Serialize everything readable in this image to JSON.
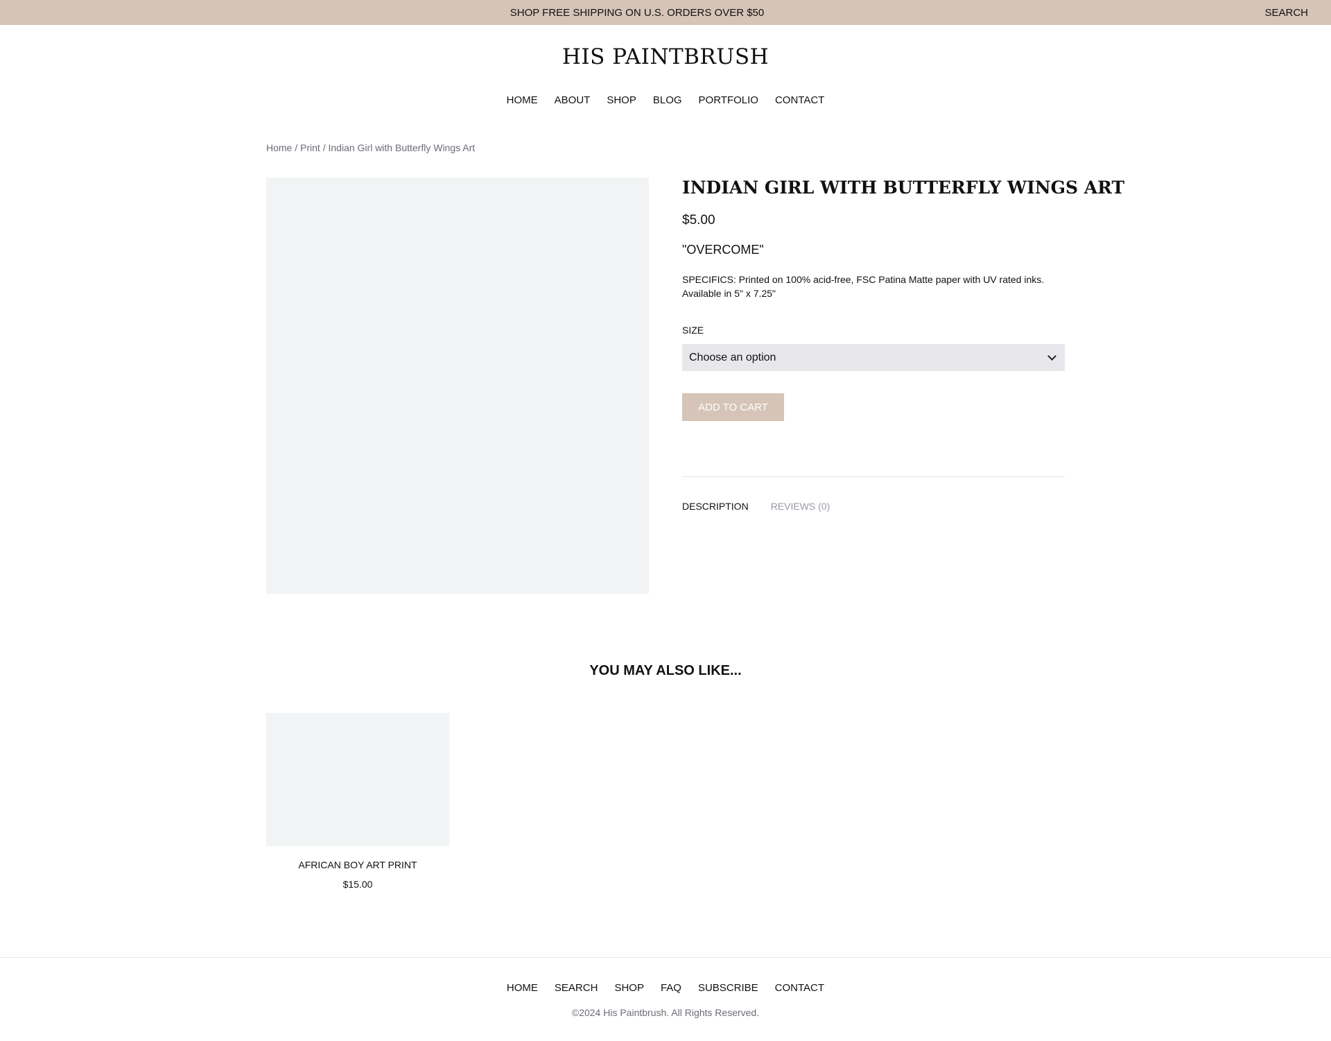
{
  "announcement": {
    "text": "SHOP FREE SHIPPING ON U.S. ORDERS OVER $50",
    "search_label": "SEARCH"
  },
  "site": {
    "title": "HIS PAINTBRUSH"
  },
  "nav": {
    "items": [
      {
        "label": "HOME"
      },
      {
        "label": "ABOUT"
      },
      {
        "label": "SHOP"
      },
      {
        "label": "BLOG"
      },
      {
        "label": "PORTFOLIO"
      },
      {
        "label": "CONTACT"
      }
    ]
  },
  "breadcrumb": {
    "home": "Home",
    "sep": " / ",
    "category": "Print",
    "current": "Indian Girl with Butterfly Wings Art"
  },
  "product": {
    "title": "INDIAN GIRL WITH BUTTERFLY WINGS ART",
    "price": "$5.00",
    "tagline": "\"OVERCOME\"",
    "specs_line1": "SPECIFICS: Printed on 100% acid-free, FSC Patina Matte paper with UV rated inks.",
    "specs_line2": "Available in 5\" x 7.25\"",
    "size_label": "SIZE",
    "size_selected": "Choose an option",
    "add_to_cart": "ADD TO CART",
    "tabs": [
      {
        "label": "DESCRIPTION",
        "active": true
      },
      {
        "label": "REVIEWS (0)",
        "active": false
      }
    ]
  },
  "related": {
    "heading": "YOU MAY ALSO LIKE...",
    "items": [
      {
        "name": "AFRICAN BOY ART PRINT",
        "price": "$15.00"
      }
    ]
  },
  "footer": {
    "nav": [
      {
        "label": "HOME"
      },
      {
        "label": "SEARCH"
      },
      {
        "label": "SHOP"
      },
      {
        "label": "FAQ"
      },
      {
        "label": "SUBSCRIBE"
      },
      {
        "label": "CONTACT"
      }
    ],
    "copyright": "©2024 His Paintbrush. All Rights Reserved."
  },
  "colors": {
    "accent": "#d5c4b7",
    "placeholder_bg": "#f2f3f5",
    "select_bg": "#e8e8ec",
    "muted_text": "#6b6b76"
  }
}
